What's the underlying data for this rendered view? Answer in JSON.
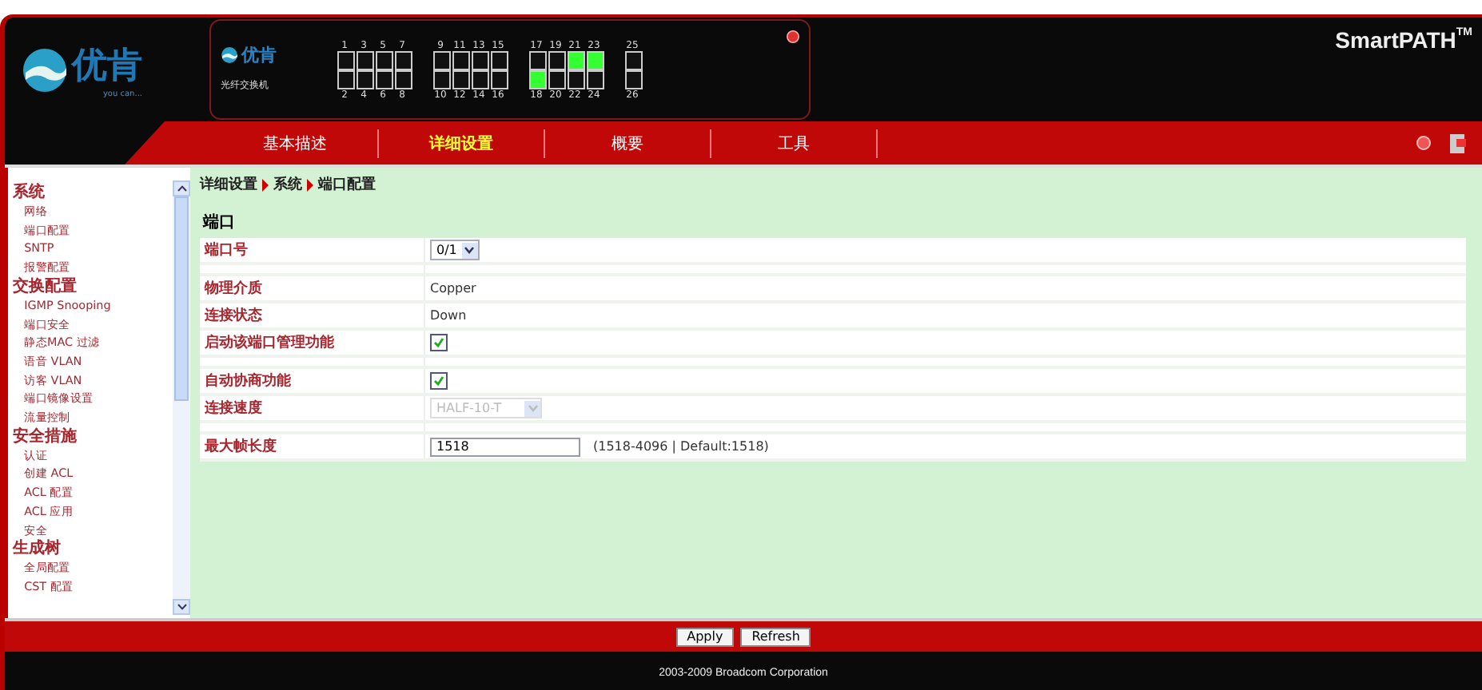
{
  "header": {
    "logo": {
      "name": "优肯",
      "tagline": "you can..."
    },
    "device": {
      "logo": "优肯",
      "model": "光纤交换机"
    },
    "brand": "SmartPATH",
    "brand_mark": "TM",
    "ports": [
      {
        "number": "1",
        "link": false
      },
      {
        "number": "2",
        "link": false
      },
      {
        "number": "3",
        "link": false
      },
      {
        "number": "4",
        "link": false
      },
      {
        "number": "5",
        "link": false
      },
      {
        "number": "6",
        "link": false
      },
      {
        "number": "7",
        "link": false
      },
      {
        "number": "8",
        "link": false
      },
      {
        "number": "9",
        "link": false
      },
      {
        "number": "10",
        "link": false
      },
      {
        "number": "11",
        "link": false
      },
      {
        "number": "12",
        "link": false
      },
      {
        "number": "13",
        "link": false
      },
      {
        "number": "14",
        "link": false
      },
      {
        "number": "15",
        "link": false
      },
      {
        "number": "16",
        "link": false
      },
      {
        "number": "17",
        "link": false
      },
      {
        "number": "18",
        "link": true
      },
      {
        "number": "19",
        "link": false
      },
      {
        "number": "20",
        "link": false
      },
      {
        "number": "21",
        "link": true
      },
      {
        "number": "22",
        "link": false
      },
      {
        "number": "23",
        "link": true
      },
      {
        "number": "24",
        "link": false
      },
      {
        "number": "25",
        "link": false
      },
      {
        "number": "26",
        "link": false
      }
    ]
  },
  "tabs": [
    {
      "label": "基本描述",
      "selected": false
    },
    {
      "label": "详细设置",
      "selected": true
    },
    {
      "label": "概要",
      "selected": false
    },
    {
      "label": "工具",
      "selected": false
    }
  ],
  "sidebar": {
    "groups": [
      {
        "label": "系统",
        "items": [
          "网络",
          "端口配置",
          "SNTP",
          "报警配置"
        ]
      },
      {
        "label": "交换配置",
        "items": [
          "IGMP Snooping",
          "端口安全",
          "静态MAC 过滤",
          "语音 VLAN",
          "访客 VLAN",
          "端口镜像设置",
          "流量控制"
        ]
      },
      {
        "label": "安全措施",
        "items": [
          "认证",
          "创建 ACL",
          "ACL 配置",
          "ACL 应用",
          "安全"
        ]
      },
      {
        "label": "生成树",
        "items": [
          "全局配置",
          "CST 配置"
        ]
      }
    ]
  },
  "breadcrumb": [
    "详细设置",
    "系统",
    "端口配置"
  ],
  "section_title": "端口",
  "rows": [
    {
      "kind": "select",
      "label": "端口号",
      "value": "0/1",
      "disabled": false
    },
    {
      "kind": "spacer"
    },
    {
      "kind": "text",
      "label": "物理介质",
      "value": "Copper"
    },
    {
      "kind": "text",
      "label": "连接状态",
      "value": "Down"
    },
    {
      "kind": "checkbox",
      "label": "启动该端口管理功能",
      "checked": true
    },
    {
      "kind": "spacer"
    },
    {
      "kind": "checkbox",
      "label": "自动协商功能",
      "checked": true
    },
    {
      "kind": "select",
      "label": "连接速度",
      "value": "HALF-10-T",
      "disabled": true
    },
    {
      "kind": "spacer"
    },
    {
      "kind": "input",
      "label": "最大帧长度",
      "value": "1518",
      "hint": "(1518-4096 | Default:1518)"
    }
  ],
  "buttons": [
    "Apply",
    "Refresh"
  ],
  "footer": "2003-2009 Broadcom Corporation"
}
